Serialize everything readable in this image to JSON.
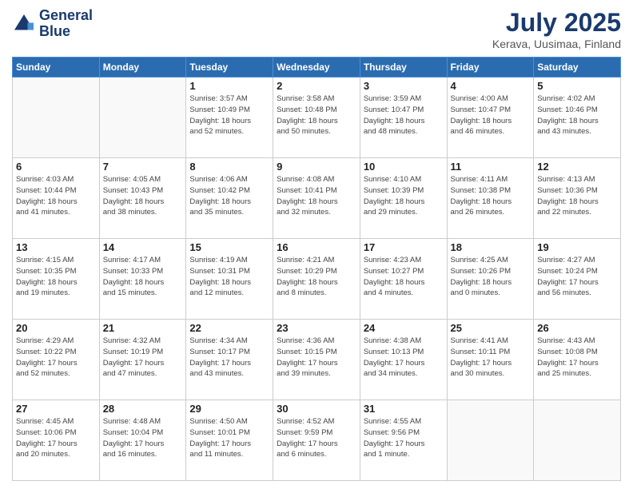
{
  "header": {
    "logo_line1": "General",
    "logo_line2": "Blue",
    "title": "July 2025",
    "subtitle": "Kerava, Uusimaa, Finland"
  },
  "weekdays": [
    "Sunday",
    "Monday",
    "Tuesday",
    "Wednesday",
    "Thursday",
    "Friday",
    "Saturday"
  ],
  "weeks": [
    [
      {
        "day": "",
        "info": ""
      },
      {
        "day": "",
        "info": ""
      },
      {
        "day": "1",
        "info": "Sunrise: 3:57 AM\nSunset: 10:49 PM\nDaylight: 18 hours\nand 52 minutes."
      },
      {
        "day": "2",
        "info": "Sunrise: 3:58 AM\nSunset: 10:48 PM\nDaylight: 18 hours\nand 50 minutes."
      },
      {
        "day": "3",
        "info": "Sunrise: 3:59 AM\nSunset: 10:47 PM\nDaylight: 18 hours\nand 48 minutes."
      },
      {
        "day": "4",
        "info": "Sunrise: 4:00 AM\nSunset: 10:47 PM\nDaylight: 18 hours\nand 46 minutes."
      },
      {
        "day": "5",
        "info": "Sunrise: 4:02 AM\nSunset: 10:46 PM\nDaylight: 18 hours\nand 43 minutes."
      }
    ],
    [
      {
        "day": "6",
        "info": "Sunrise: 4:03 AM\nSunset: 10:44 PM\nDaylight: 18 hours\nand 41 minutes."
      },
      {
        "day": "7",
        "info": "Sunrise: 4:05 AM\nSunset: 10:43 PM\nDaylight: 18 hours\nand 38 minutes."
      },
      {
        "day": "8",
        "info": "Sunrise: 4:06 AM\nSunset: 10:42 PM\nDaylight: 18 hours\nand 35 minutes."
      },
      {
        "day": "9",
        "info": "Sunrise: 4:08 AM\nSunset: 10:41 PM\nDaylight: 18 hours\nand 32 minutes."
      },
      {
        "day": "10",
        "info": "Sunrise: 4:10 AM\nSunset: 10:39 PM\nDaylight: 18 hours\nand 29 minutes."
      },
      {
        "day": "11",
        "info": "Sunrise: 4:11 AM\nSunset: 10:38 PM\nDaylight: 18 hours\nand 26 minutes."
      },
      {
        "day": "12",
        "info": "Sunrise: 4:13 AM\nSunset: 10:36 PM\nDaylight: 18 hours\nand 22 minutes."
      }
    ],
    [
      {
        "day": "13",
        "info": "Sunrise: 4:15 AM\nSunset: 10:35 PM\nDaylight: 18 hours\nand 19 minutes."
      },
      {
        "day": "14",
        "info": "Sunrise: 4:17 AM\nSunset: 10:33 PM\nDaylight: 18 hours\nand 15 minutes."
      },
      {
        "day": "15",
        "info": "Sunrise: 4:19 AM\nSunset: 10:31 PM\nDaylight: 18 hours\nand 12 minutes."
      },
      {
        "day": "16",
        "info": "Sunrise: 4:21 AM\nSunset: 10:29 PM\nDaylight: 18 hours\nand 8 minutes."
      },
      {
        "day": "17",
        "info": "Sunrise: 4:23 AM\nSunset: 10:27 PM\nDaylight: 18 hours\nand 4 minutes."
      },
      {
        "day": "18",
        "info": "Sunrise: 4:25 AM\nSunset: 10:26 PM\nDaylight: 18 hours\nand 0 minutes."
      },
      {
        "day": "19",
        "info": "Sunrise: 4:27 AM\nSunset: 10:24 PM\nDaylight: 17 hours\nand 56 minutes."
      }
    ],
    [
      {
        "day": "20",
        "info": "Sunrise: 4:29 AM\nSunset: 10:22 PM\nDaylight: 17 hours\nand 52 minutes."
      },
      {
        "day": "21",
        "info": "Sunrise: 4:32 AM\nSunset: 10:19 PM\nDaylight: 17 hours\nand 47 minutes."
      },
      {
        "day": "22",
        "info": "Sunrise: 4:34 AM\nSunset: 10:17 PM\nDaylight: 17 hours\nand 43 minutes."
      },
      {
        "day": "23",
        "info": "Sunrise: 4:36 AM\nSunset: 10:15 PM\nDaylight: 17 hours\nand 39 minutes."
      },
      {
        "day": "24",
        "info": "Sunrise: 4:38 AM\nSunset: 10:13 PM\nDaylight: 17 hours\nand 34 minutes."
      },
      {
        "day": "25",
        "info": "Sunrise: 4:41 AM\nSunset: 10:11 PM\nDaylight: 17 hours\nand 30 minutes."
      },
      {
        "day": "26",
        "info": "Sunrise: 4:43 AM\nSunset: 10:08 PM\nDaylight: 17 hours\nand 25 minutes."
      }
    ],
    [
      {
        "day": "27",
        "info": "Sunrise: 4:45 AM\nSunset: 10:06 PM\nDaylight: 17 hours\nand 20 minutes."
      },
      {
        "day": "28",
        "info": "Sunrise: 4:48 AM\nSunset: 10:04 PM\nDaylight: 17 hours\nand 16 minutes."
      },
      {
        "day": "29",
        "info": "Sunrise: 4:50 AM\nSunset: 10:01 PM\nDaylight: 17 hours\nand 11 minutes."
      },
      {
        "day": "30",
        "info": "Sunrise: 4:52 AM\nSunset: 9:59 PM\nDaylight: 17 hours\nand 6 minutes."
      },
      {
        "day": "31",
        "info": "Sunrise: 4:55 AM\nSunset: 9:56 PM\nDaylight: 17 hours\nand 1 minute."
      },
      {
        "day": "",
        "info": ""
      },
      {
        "day": "",
        "info": ""
      }
    ]
  ]
}
